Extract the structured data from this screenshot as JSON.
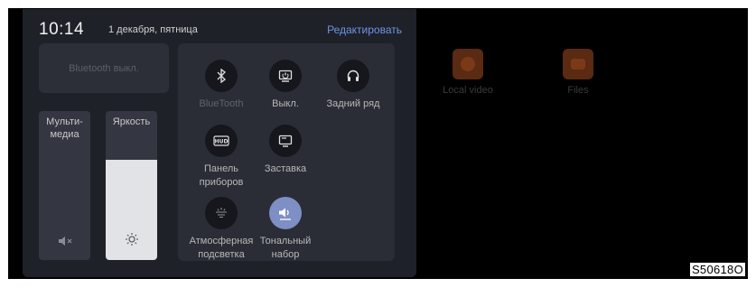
{
  "status": {
    "time": "10:14",
    "date": "1 декабря, пятница",
    "edit_label": "Редактировать"
  },
  "bluetooth_card": {
    "label": "Bluetooth выкл."
  },
  "sliders": {
    "media": {
      "label": "Мульти-\nмедиа",
      "icon": "volume-muted-icon"
    },
    "brightness": {
      "label": "Яркость",
      "icon": "sun-icon",
      "level": 0.67
    }
  },
  "tiles": [
    {
      "label": "BlueTooth",
      "icon": "bluetooth-icon",
      "active": false,
      "dim": true
    },
    {
      "label": "Выкл.",
      "icon": "power-screen-icon",
      "active": false,
      "dim": false
    },
    {
      "label": "Задний ряд",
      "icon": "headphones-icon",
      "active": false,
      "dim": false
    },
    {
      "label": "Панель приборов",
      "icon": "hud-icon",
      "active": false,
      "dim": false
    },
    {
      "label": "Заставка",
      "icon": "screensaver-icon",
      "active": false,
      "dim": false
    },
    {
      "label": "Атмосферная подсветка",
      "icon": "ambient-light-icon",
      "active": false,
      "dim": false
    },
    {
      "label": "Тональный набор",
      "icon": "speaker-icon",
      "active": true,
      "dim": false
    }
  ],
  "background_apps": [
    {
      "label": "Local video",
      "icon": "play-icon"
    },
    {
      "label": "Files",
      "icon": "folder-icon"
    }
  ],
  "figure_code": "S50618O",
  "colors": {
    "panel": "#1f2129",
    "accent": "#6f94e8",
    "active_tile": "#7d8fc4"
  }
}
